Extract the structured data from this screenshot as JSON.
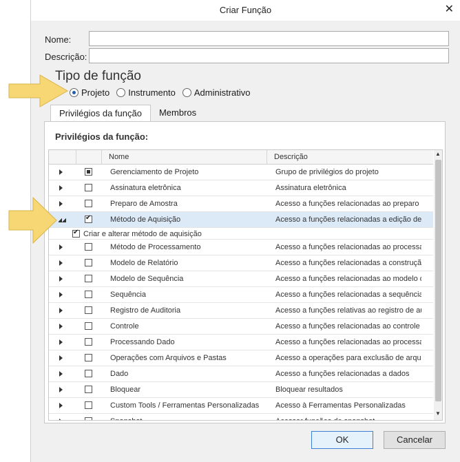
{
  "window": {
    "title": "Criar Função"
  },
  "form": {
    "name_label": "Nome:",
    "name_value": "",
    "desc_label": "Descrição:",
    "desc_value": ""
  },
  "function_type": {
    "heading": "Tipo de função",
    "options": [
      "Projeto",
      "Instrumento",
      "Administrativo"
    ],
    "selected": "Projeto"
  },
  "tabs": [
    "Privilégios da função",
    "Membros"
  ],
  "active_tab": "Privilégios da função",
  "panel": {
    "title": "Privilégios da função:"
  },
  "grid": {
    "columns": [
      "Nome",
      "Descrição"
    ],
    "rows": [
      {
        "name": "Gerenciamento de Projeto",
        "desc": "Grupo de privilégios do projeto",
        "check": "partial"
      },
      {
        "name": "Assinatura eletrônica",
        "desc": "Assinatura eletrônica",
        "check": "none"
      },
      {
        "name": "Preparo de Amostra",
        "desc": "Acesso a funções relacionadas ao preparo d",
        "check": "none"
      },
      {
        "name": "Método de Aquisição",
        "desc": "Acesso a funções relacionadas  a edição de",
        "check": "checked",
        "expanded": true,
        "selected": true
      },
      {
        "name": "Método de Processamento",
        "desc": "Acesso a funções relacionadas ao processar",
        "check": "none"
      },
      {
        "name": "Modelo de Relatório",
        "desc": "Acesso a funções relacionadas a construção",
        "check": "none"
      },
      {
        "name": "Modelo de Sequência",
        "desc": "Acesso a funções relacionadas ao modelo d",
        "check": "none"
      },
      {
        "name": "Sequência",
        "desc": "Acesso a funções relacionadas a sequências",
        "check": "none"
      },
      {
        "name": "Registro de Auditoria",
        "desc": "Acesso a funções relativas ao registro de au",
        "check": "none"
      },
      {
        "name": "Controle",
        "desc": "Acesso a funções relacionadas ao controle c",
        "check": "none"
      },
      {
        "name": "Processando Dado",
        "desc": "Acesso a funções relacionadas ao processar",
        "check": "none"
      },
      {
        "name": "Operações com Arquivos e Pastas",
        "desc": "Acesso a operações para exclusão de arquiv",
        "check": "none"
      },
      {
        "name": "Dado",
        "desc": "Acesso a funções relacionadas a dados",
        "check": "none"
      },
      {
        "name": "Bloquear",
        "desc": "Bloquear resultados",
        "check": "none"
      },
      {
        "name": "Custom Tools / Ferramentas Personalizadas",
        "desc": "Acesso à Ferramentas Personalizadas",
        "check": "none"
      },
      {
        "name": "Snapshot",
        "desc": "Acessar funções de snapshot",
        "check": "none"
      }
    ],
    "child_row": {
      "label": "Criar e alterar método de aquisição",
      "checked": true
    }
  },
  "buttons": {
    "ok": "OK",
    "cancel": "Cancelar"
  },
  "colors": {
    "highlight_arrow": "#f7d774",
    "selected_row": "#dce9f7",
    "accent": "#1a5fb4"
  }
}
